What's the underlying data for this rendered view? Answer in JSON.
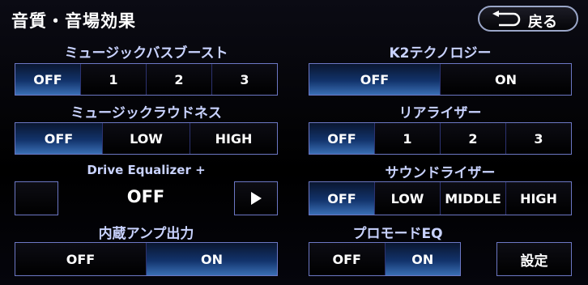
{
  "header": {
    "title": "音質・音場効果",
    "back_label": "戻る"
  },
  "music_bass_boost": {
    "label": "ミュージックバスブースト",
    "options": [
      "OFF",
      "1",
      "2",
      "3"
    ],
    "selected": "OFF"
  },
  "k2_technology": {
    "label": "K2テクノロジー",
    "options": [
      "OFF",
      "ON"
    ],
    "selected": "OFF"
  },
  "music_loudness": {
    "label": "ミュージックラウドネス",
    "options": [
      "OFF",
      "LOW",
      "HIGH"
    ],
    "selected": "OFF"
  },
  "rear_riser": {
    "label": "リアライザー",
    "options": [
      "OFF",
      "1",
      "2",
      "3"
    ],
    "selected": "OFF"
  },
  "drive_equalizer": {
    "label": "Drive Equalizer +",
    "value": "OFF",
    "play_icon": "play-icon"
  },
  "sound_riser": {
    "label": "サウンドライザー",
    "options": [
      "OFF",
      "LOW",
      "MIDDLE",
      "HIGH"
    ],
    "selected": "OFF"
  },
  "internal_amp": {
    "label": "内蔵アンプ出力",
    "options": [
      "OFF",
      "ON"
    ],
    "selected": "ON"
  },
  "pro_mode_eq": {
    "label": "プロモードEQ",
    "options": [
      "OFF",
      "ON"
    ],
    "selected": "ON",
    "settings_label": "設定"
  },
  "colors": {
    "accent_active": "#12336b",
    "border": "#6c77c4",
    "label_text": "#c9d3ff"
  }
}
